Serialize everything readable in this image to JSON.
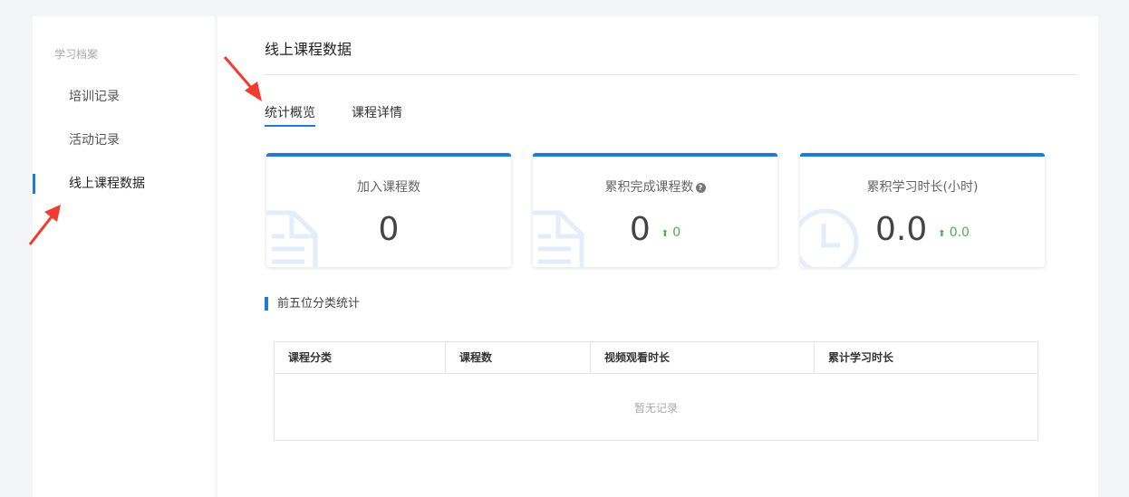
{
  "sidebar": {
    "heading": "学习档案",
    "items": [
      {
        "label": "培训记录",
        "active": false
      },
      {
        "label": "活动记录",
        "active": false
      },
      {
        "label": "线上课程数据",
        "active": true
      }
    ]
  },
  "main": {
    "title": "线上课程数据",
    "tabs": [
      {
        "label": "统计概览",
        "active": true
      },
      {
        "label": "课程详情",
        "active": false
      }
    ],
    "cards": [
      {
        "label": "加入课程数",
        "value": "0",
        "icon": "document-icon"
      },
      {
        "label": "累积完成课程数",
        "value": "0",
        "delta": "0",
        "icon": "document-icon",
        "help": "?"
      },
      {
        "label": "累积学习时长(小时)",
        "value": "0.0",
        "delta": "0.0",
        "icon": "clock-icon"
      }
    ],
    "section_title": "前五位分类统计",
    "table": {
      "columns": [
        "课程分类",
        "课程数",
        "视频观看时长",
        "累计学习时长"
      ],
      "empty_text": "暂无记录"
    }
  },
  "colors": {
    "accent": "#1f7ad8",
    "positive": "#4caf50",
    "annotation_arrow": "#f23b2f"
  }
}
